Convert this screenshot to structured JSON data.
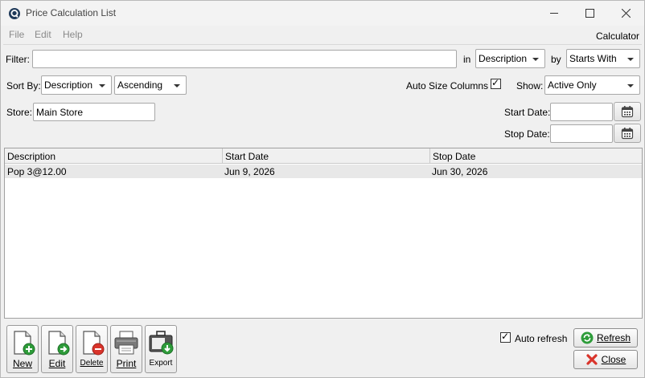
{
  "window": {
    "title": "Price Calculation List"
  },
  "menu": {
    "file": "File",
    "edit": "Edit",
    "help": "Help",
    "right_label": "Calculator"
  },
  "filter": {
    "label": "Filter:",
    "value": "",
    "in_label": "in",
    "field_selected": "Description",
    "by_label": "by",
    "mode_selected": "Starts With"
  },
  "sort": {
    "label": "Sort By:",
    "field_selected": "Description",
    "order_selected": "Ascending",
    "auto_size_label": "Auto Size Columns",
    "auto_size_checked": true,
    "show_label": "Show:",
    "show_selected": "Active Only"
  },
  "store": {
    "label": "Store:",
    "value": "Main Store"
  },
  "dates": {
    "start_label": "Start Date:",
    "start_value": "",
    "stop_label": "Stop Date:",
    "stop_value": ""
  },
  "table": {
    "columns": [
      "Description",
      "Start Date",
      "Stop Date"
    ],
    "rows": [
      [
        "Pop 3@12.00",
        "Jun 9, 2026",
        "Jun 30, 2026"
      ]
    ]
  },
  "toolbar": {
    "new": "New",
    "edit": "Edit",
    "delete": "Delete",
    "print": "Print",
    "export": "Export"
  },
  "footer": {
    "auto_refresh_label": "Auto refresh",
    "auto_refresh_checked": true,
    "refresh": "Refresh",
    "close": "Close"
  },
  "colors": {
    "accent_green": "#2e9c3a",
    "close_red": "#d9342b"
  }
}
